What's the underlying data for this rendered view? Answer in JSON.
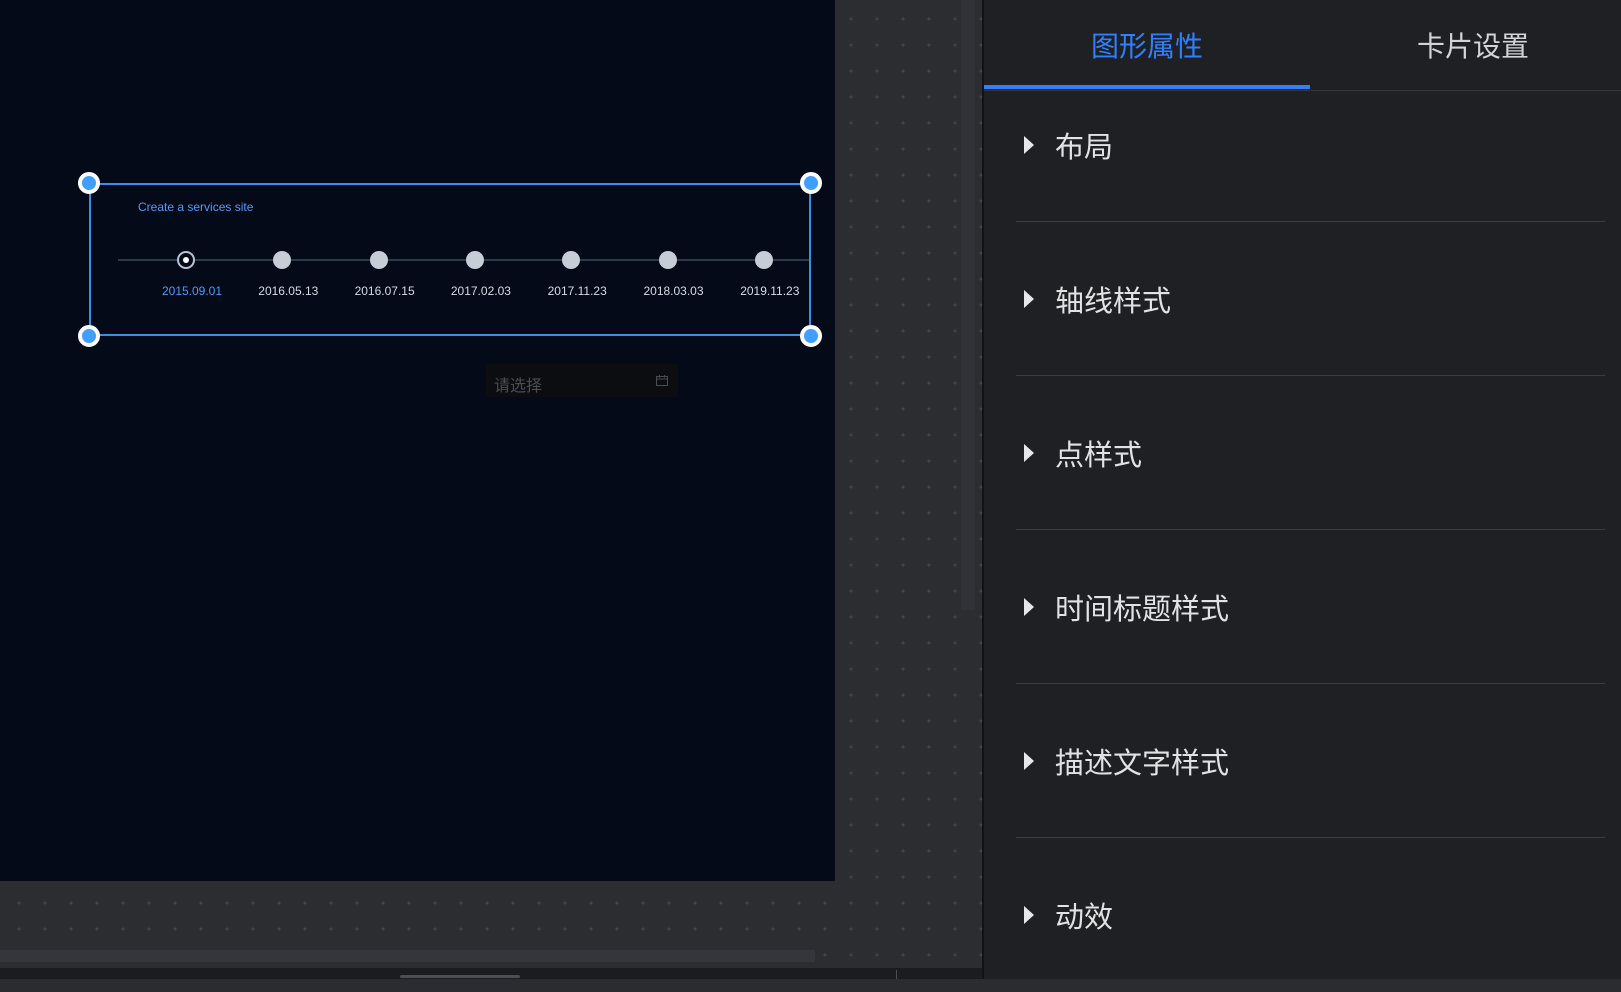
{
  "canvas": {
    "timeline": {
      "title": "Create a services site",
      "dates": [
        "2015.09.01",
        "2016.05.13",
        "2016.07.15",
        "2017.02.03",
        "2017.11.23",
        "2018.03.03",
        "2019.11.23"
      ],
      "active_index": 0
    },
    "date_picker": {
      "placeholder": "请选择"
    },
    "colors": {
      "stage_bg": "#040a18",
      "selection": "#409eff",
      "active_text": "#4e9bff"
    }
  },
  "panel": {
    "tabs": [
      {
        "label": "图形属性",
        "active": true
      },
      {
        "label": "卡片设置",
        "active": false
      }
    ],
    "sections": [
      {
        "label": "布局"
      },
      {
        "label": "轴线样式"
      },
      {
        "label": "点样式"
      },
      {
        "label": "时间标题样式"
      },
      {
        "label": "描述文字样式"
      },
      {
        "label": "动效"
      }
    ],
    "accent": "#2f7fff"
  }
}
